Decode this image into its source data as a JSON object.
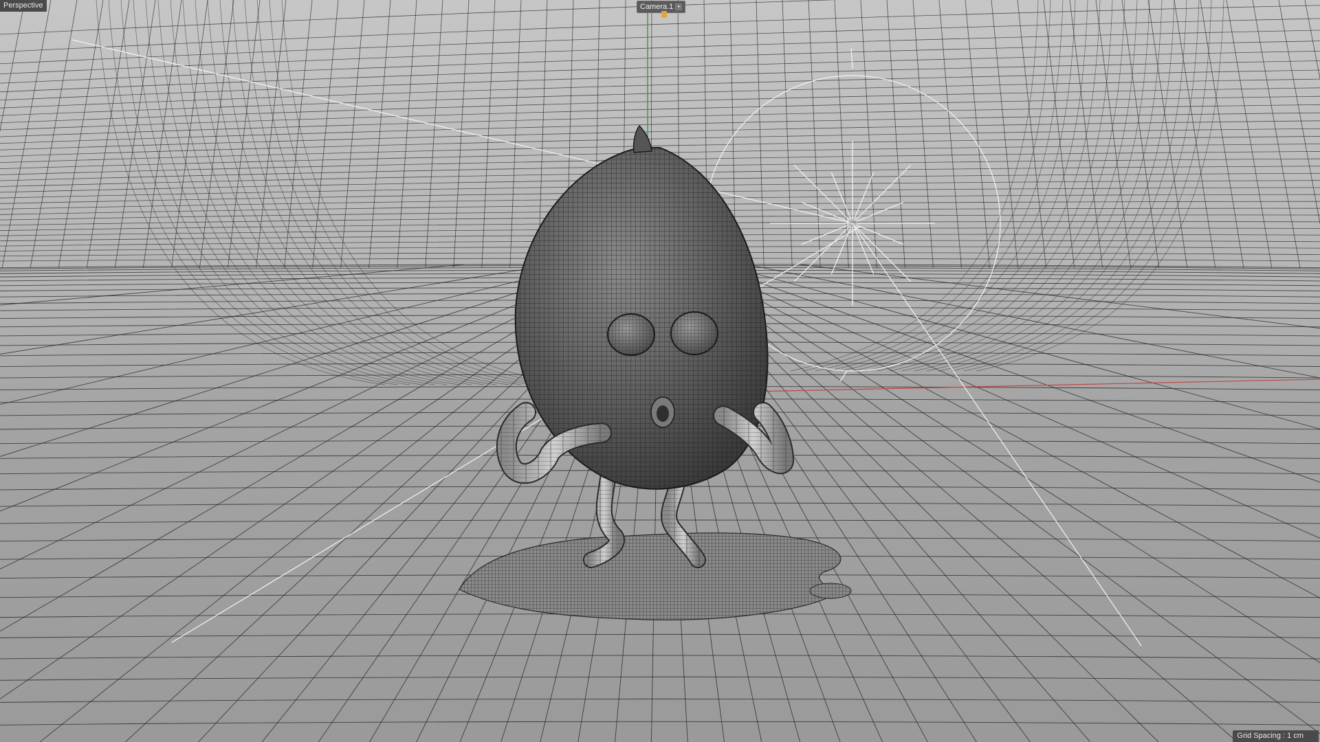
{
  "viewport": {
    "view_name": "Perspective",
    "camera": "Camera.1",
    "camera_button_glyph": "•",
    "grid_spacing": "Grid Spacing : 1 cm"
  },
  "colors": {
    "background": "#a8a8a8",
    "wire": "#1e1e1e",
    "axis_x": "#c04545",
    "axis_y": "#2f9a4b",
    "light_gizmo": "#f4f4f4",
    "camera_marker": "#e2a440"
  }
}
